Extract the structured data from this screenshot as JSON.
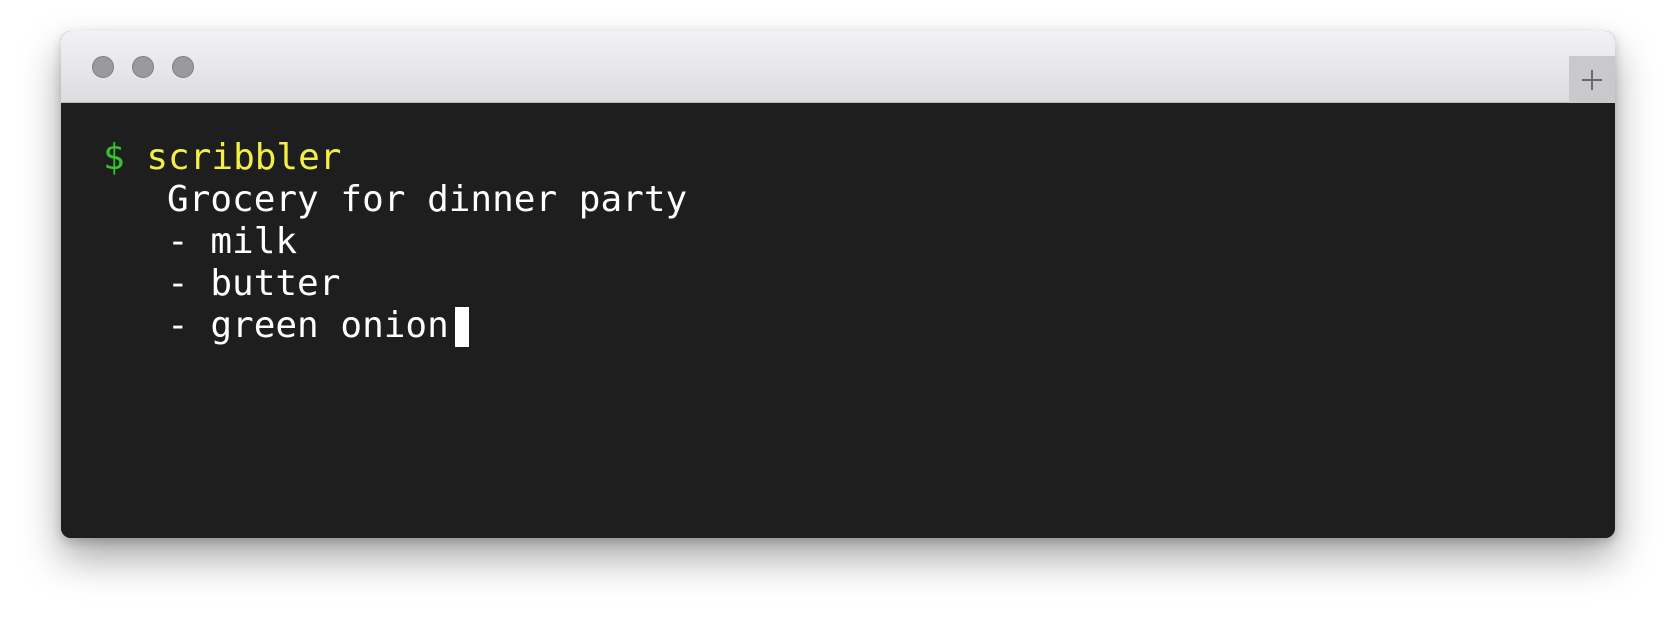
{
  "window": {
    "buttons": [
      "close",
      "minimize",
      "zoom"
    ],
    "new_tab_icon": "plus-icon"
  },
  "terminal": {
    "prompt_symbol": "$",
    "command": "scribbler",
    "output_lines": [
      "Grocery for dinner party",
      "- milk",
      "- butter",
      "- green onion"
    ]
  },
  "colors": {
    "terminal_bg": "#1e1e1e",
    "prompt": "#33c62b",
    "command": "#f2f046",
    "text": "#ffffff"
  }
}
